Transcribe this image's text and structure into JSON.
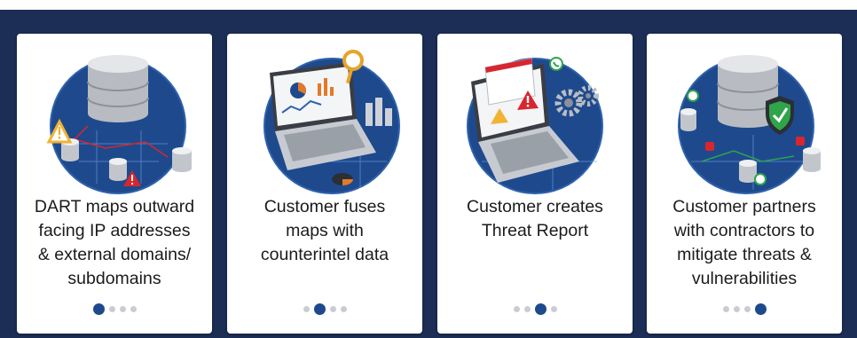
{
  "colors": {
    "frame": "#1c2e55",
    "card": "#ffffff",
    "accent": "#1e4a8d",
    "dot_inactive": "#c9cdd3"
  },
  "cards": [
    {
      "illustration": "database-network-alert-illustration",
      "caption": "DART maps outward\nfacing IP addresses\n& external domains/\nsubdomains",
      "active_step": 1,
      "total_steps": 4
    },
    {
      "illustration": "laptop-analytics-magnifier-illustration",
      "caption": "Customer fuses\nmaps with\ncounterintel data",
      "active_step": 2,
      "total_steps": 4
    },
    {
      "illustration": "laptop-threat-report-gears-illustration",
      "caption": "Customer creates\nThreat Report",
      "active_step": 3,
      "total_steps": 4
    },
    {
      "illustration": "database-shield-partners-illustration",
      "caption": "Customer partners\nwith contractors to\nmitigate threats &\nvulnerabilities",
      "active_step": 4,
      "total_steps": 4
    }
  ]
}
